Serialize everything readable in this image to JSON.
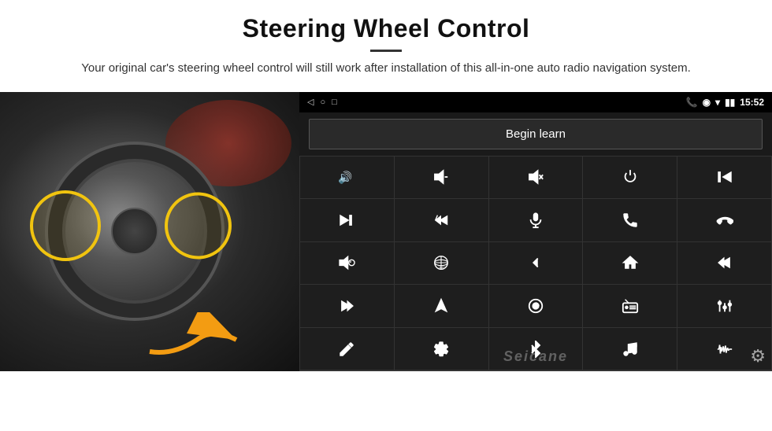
{
  "header": {
    "title": "Steering Wheel Control",
    "subtitle": "Your original car's steering wheel control will still work after installation of this all-in-one auto radio navigation system.",
    "divider": true
  },
  "statusBar": {
    "time": "15:52",
    "icons": [
      "◁",
      "○",
      "□"
    ]
  },
  "beginLearnBtn": "Begin learn",
  "controlGrid": {
    "rows": [
      [
        "vol+",
        "vol-",
        "mute",
        "power",
        "prev-track"
      ],
      [
        "skip-fwd",
        "skip-bwd",
        "mic",
        "phone",
        "hang-up"
      ],
      [
        "speaker",
        "360-cam",
        "back",
        "home",
        "prev-chapter"
      ],
      [
        "next-chapter",
        "navigate",
        "source",
        "radio",
        "equalizer"
      ],
      [
        "pen",
        "settings2",
        "bluetooth",
        "music",
        "waveform"
      ]
    ]
  },
  "watermark": "Seicane",
  "settingsGear": "⚙"
}
